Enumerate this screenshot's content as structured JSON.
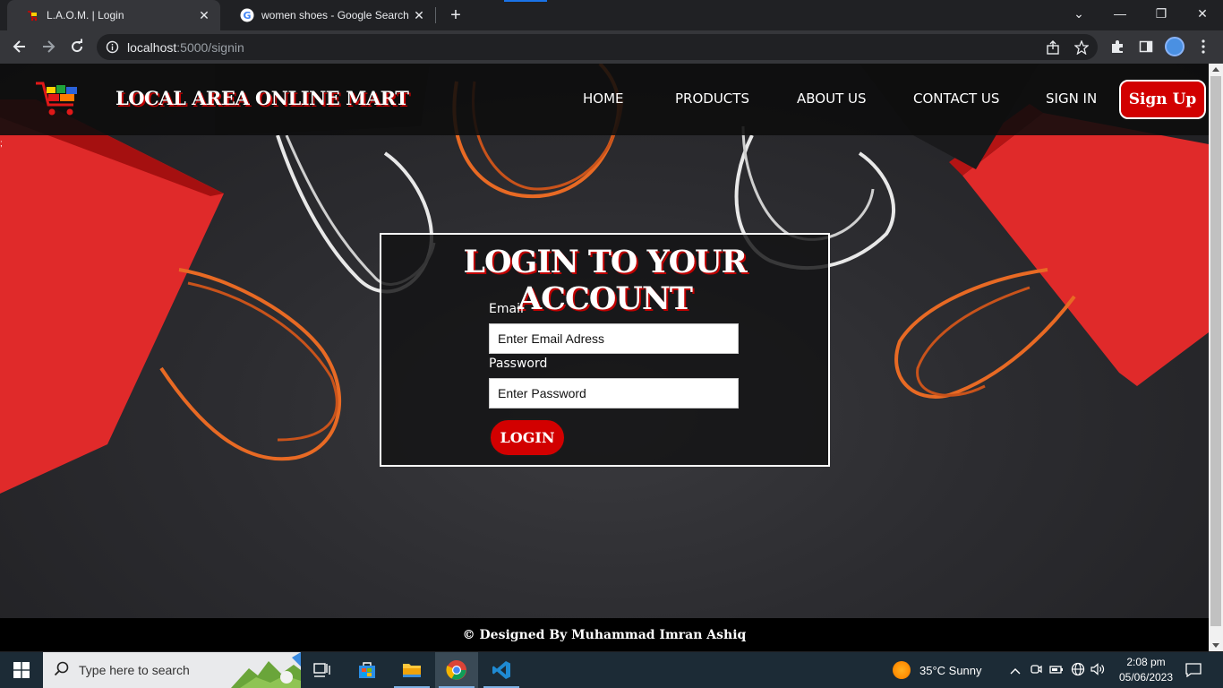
{
  "browser": {
    "tabs": [
      {
        "title": "L.A.O.M. | Login",
        "active": true
      },
      {
        "title": "women shoes - Google Search",
        "active": false
      }
    ],
    "url_host": "localhost",
    "url_path": ":5000/signin"
  },
  "site": {
    "brand": "LOCAL AREA ONLINE MART",
    "nav": [
      "HOME",
      "PRODUCTS",
      "ABOUT US",
      "CONTACT US",
      "SIGN IN"
    ],
    "signup_label": "Sign Up",
    "stray_char": ";"
  },
  "login": {
    "title": "LOGIN TO YOUR ACCOUNT",
    "email_label": "Email",
    "email_placeholder": "Enter Email Adress",
    "password_label": "Password",
    "password_placeholder": "Enter Password",
    "button_label": "LOGIN"
  },
  "footer": {
    "text": "© Designed By Muhammad Imran Ashiq"
  },
  "taskbar": {
    "search_placeholder": "Type here to search",
    "weather": "35°C  Sunny",
    "time": "2:08 pm",
    "date": "05/06/2023"
  },
  "colors": {
    "accent_red": "#d20000",
    "chrome_dark": "#202124",
    "chrome_toolbar": "#35363a"
  }
}
